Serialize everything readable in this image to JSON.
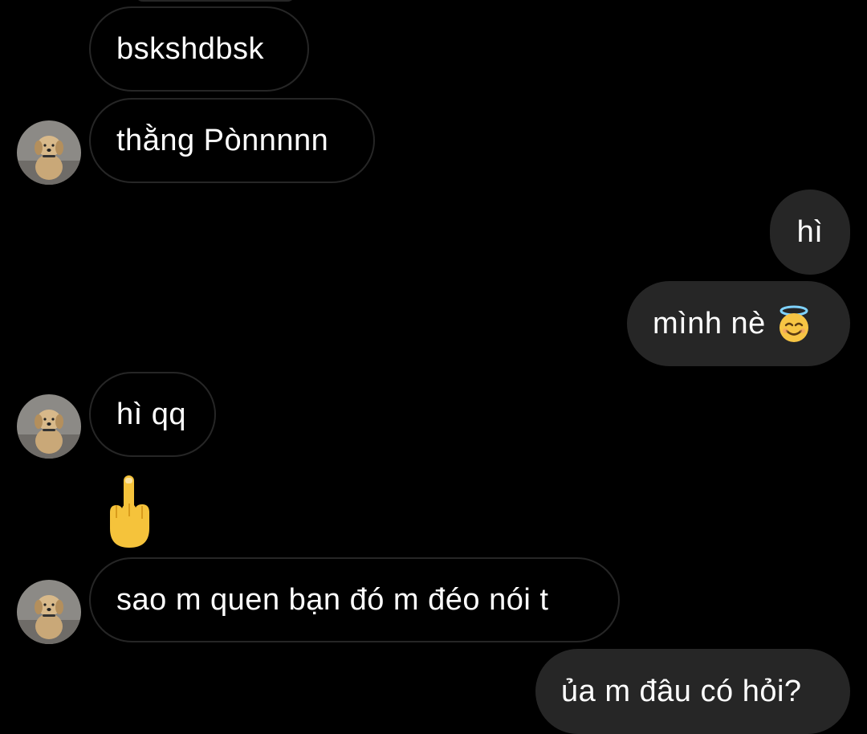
{
  "conversation": {
    "messages": [
      {
        "id": "m1",
        "direction": "incoming",
        "text": "bskshdbsk"
      },
      {
        "id": "m2",
        "direction": "incoming",
        "text": "thằng Pònnnnn"
      },
      {
        "id": "m3",
        "direction": "outgoing",
        "text": "hì"
      },
      {
        "id": "m4",
        "direction": "outgoing",
        "text": "mình nè",
        "emoji": "smiling-face-with-halo-icon"
      },
      {
        "id": "m5",
        "direction": "incoming",
        "text": "hì qq"
      },
      {
        "id": "m6",
        "direction": "incoming",
        "emoji": "middle-finger-icon"
      },
      {
        "id": "m7",
        "direction": "incoming",
        "text": "sao m quen bạn đó m đéo nói t"
      },
      {
        "id": "m8",
        "direction": "outgoing",
        "text": "ủa m đâu có hỏi?"
      }
    ],
    "colors": {
      "background": "#000000",
      "incoming_border": "#262626",
      "outgoing_bubble": "#262626",
      "text": "#ffffff"
    },
    "avatar_icon": "puppy-avatar-icon"
  }
}
